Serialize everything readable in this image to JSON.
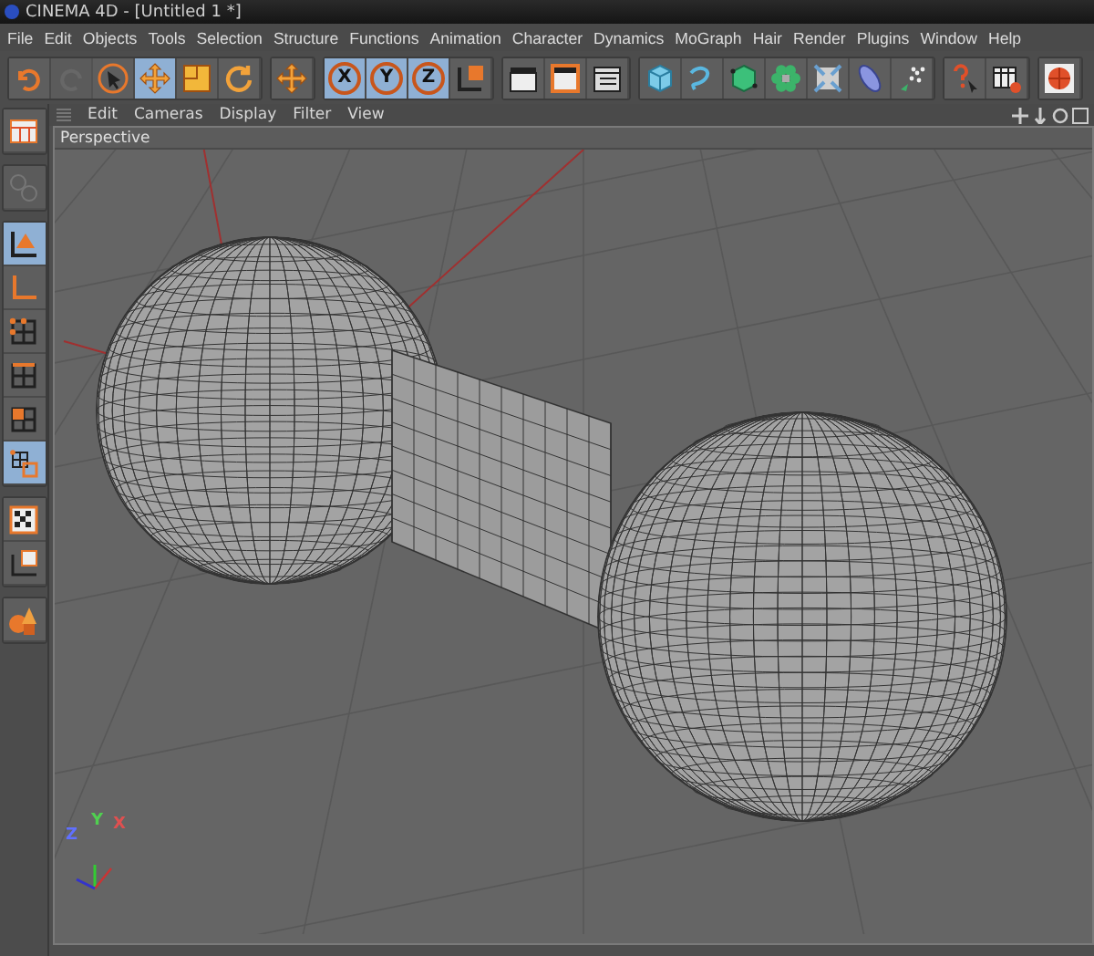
{
  "window": {
    "title": "CINEMA 4D - [Untitled 1 *]"
  },
  "menu": [
    "File",
    "Edit",
    "Objects",
    "Tools",
    "Selection",
    "Structure",
    "Functions",
    "Animation",
    "Character",
    "Dynamics",
    "MoGraph",
    "Hair",
    "Render",
    "Plugins",
    "Window",
    "Help"
  ],
  "toolbar": [
    {
      "items": [
        {
          "selected": false
        },
        {
          "selected": false,
          "disabled": true
        },
        {
          "selected": false
        },
        {
          "selected": true
        },
        {
          "selected": false
        },
        {
          "selected": false
        }
      ]
    },
    {
      "items": [
        {
          "selected": false
        }
      ]
    },
    {
      "items": [
        {
          "label": "X",
          "selected": true
        },
        {
          "label": "Y",
          "selected": true
        },
        {
          "label": "Z",
          "selected": true
        },
        {
          "selected": false
        }
      ]
    },
    {
      "items": [
        {
          "selected": false
        },
        {
          "selected": false
        },
        {
          "selected": false
        }
      ]
    },
    {
      "items": [
        {
          "selected": false
        },
        {
          "selected": false
        },
        {
          "selected": false
        },
        {
          "selected": false
        },
        {
          "selected": false
        },
        {
          "selected": false
        },
        {
          "selected": false
        }
      ]
    },
    {
      "items": [
        {
          "selected": false
        },
        {
          "selected": false
        }
      ]
    },
    {
      "items": [
        {
          "selected": false
        }
      ]
    }
  ],
  "left_tools": [
    {
      "items": [
        {
          "selected": false
        }
      ]
    },
    {
      "items": [
        {
          "selected": false,
          "disabled": true
        }
      ]
    },
    {
      "items": [
        {
          "selected": true
        },
        {
          "selected": false
        },
        {
          "selected": false
        },
        {
          "selected": false
        },
        {
          "selected": false
        },
        {
          "selected": true
        }
      ]
    },
    {
      "items": [
        {
          "selected": false
        },
        {
          "selected": false
        }
      ]
    },
    {
      "items": [
        {
          "selected": false
        }
      ]
    }
  ],
  "viewport": {
    "menu": [
      "Edit",
      "Cameras",
      "Display",
      "Filter",
      "View"
    ],
    "label": "Perspective",
    "axes": [
      "X",
      "Y",
      "Z"
    ]
  }
}
